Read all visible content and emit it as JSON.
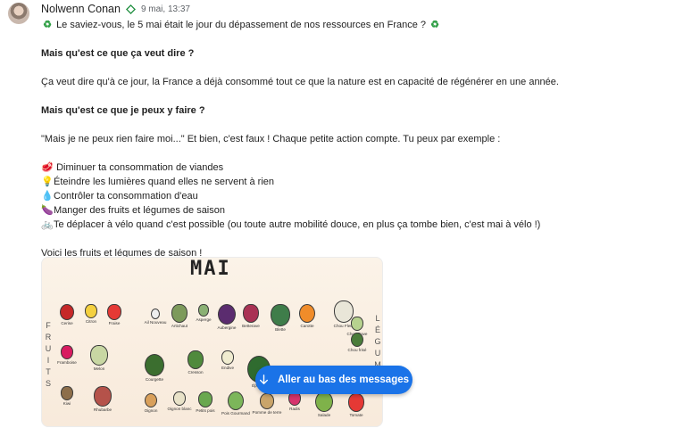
{
  "message": {
    "author": "Nolwenn Conan",
    "timestamp": "9 mai, 13:37",
    "intro": "Le saviez-vous, le 5 mai était le jour du dépassement de nos ressources en France ?",
    "heading1": "Mais qu'est ce que ça veut dire ?",
    "para1": "Ça veut dire qu'à ce jour, la France a déjà consommé tout ce que la nature est en capacité de régénérer en une année.",
    "heading2": "Mais qu'est ce que je peux y faire ?",
    "para2": "\"Mais je ne peux rien faire moi...\" Et bien, c'est faux ! Chaque petite action compte. Tu peux par exemple :",
    "actions": [
      {
        "icon": "meat-icon",
        "text": "Diminuer ta consommation de viandes"
      },
      {
        "icon": "light-bulb-icon",
        "text": "Éteindre les lumières quand elles ne servent à rien"
      },
      {
        "icon": "droplet-icon",
        "text": "Contrôler ta consommation d'eau"
      },
      {
        "icon": "eggplant-icon",
        "text": "Manger des fruits et légumes de saison"
      },
      {
        "icon": "bicycle-icon",
        "text": "Te déplacer à vélo quand c'est possible (ou toute autre mobilité douce, en plus ça tombe bien, c'est mai à vélo !)"
      }
    ],
    "outro": "Voici les fruits et légumes de saison !"
  },
  "poster": {
    "title": "MAI",
    "fruits_label": "FRUITS",
    "vegetables_label": "LÉGUM",
    "items": [
      {
        "label": "Cerise",
        "color": "#c62828"
      },
      {
        "label": "Citron",
        "color": "#f4d03f"
      },
      {
        "label": "Fraise",
        "color": "#e53935"
      },
      {
        "label": "Ail Nouveau",
        "color": "#eeeeee"
      },
      {
        "label": "Artichaut",
        "color": "#7d9a5b"
      },
      {
        "label": "Asperge",
        "color": "#8bb174"
      },
      {
        "label": "Aubergine",
        "color": "#5b2c6f"
      },
      {
        "label": "Betterave",
        "color": "#a93254"
      },
      {
        "label": "Blette",
        "color": "#3f7d4a"
      },
      {
        "label": "Carotte",
        "color": "#f08c2a"
      },
      {
        "label": "Chou Fleur",
        "color": "#e9e6d8"
      },
      {
        "label": "Chou Rave",
        "color": "#b7d28f"
      },
      {
        "label": "Chou frisé",
        "color": "#4a7c3a"
      },
      {
        "label": "Framboise",
        "color": "#d81b60"
      },
      {
        "label": "Melon",
        "color": "#c8d7a3"
      },
      {
        "label": "Courgette",
        "color": "#3b6e2f"
      },
      {
        "label": "Cresson",
        "color": "#4f8a3c"
      },
      {
        "label": "Endive",
        "color": "#f0ecd0"
      },
      {
        "label": "Épinard",
        "color": "#2f6b2f"
      },
      {
        "label": "Kiwi",
        "color": "#8d6e4a"
      },
      {
        "label": "Rhubarbe",
        "color": "#b5524a"
      },
      {
        "label": "Oignon",
        "color": "#d9a05b"
      },
      {
        "label": "Oignon blanc",
        "color": "#e8e2c8"
      },
      {
        "label": "Petits pois",
        "color": "#6aa84f"
      },
      {
        "label": "Pois Gourmand",
        "color": "#7cb65a"
      },
      {
        "label": "Pomme de terre",
        "color": "#c9a46a"
      },
      {
        "label": "Radis",
        "color": "#d6336c"
      },
      {
        "label": "Salade",
        "color": "#7fb24a"
      },
      {
        "label": "Tomate",
        "color": "#e53935"
      }
    ]
  },
  "scroll_button": {
    "label": "Aller au bas des messages",
    "icon": "arrow-down-icon",
    "color": "#1a73e8"
  },
  "colors": {
    "accent": "#1a73e8",
    "verified": "#1e8e3e"
  }
}
